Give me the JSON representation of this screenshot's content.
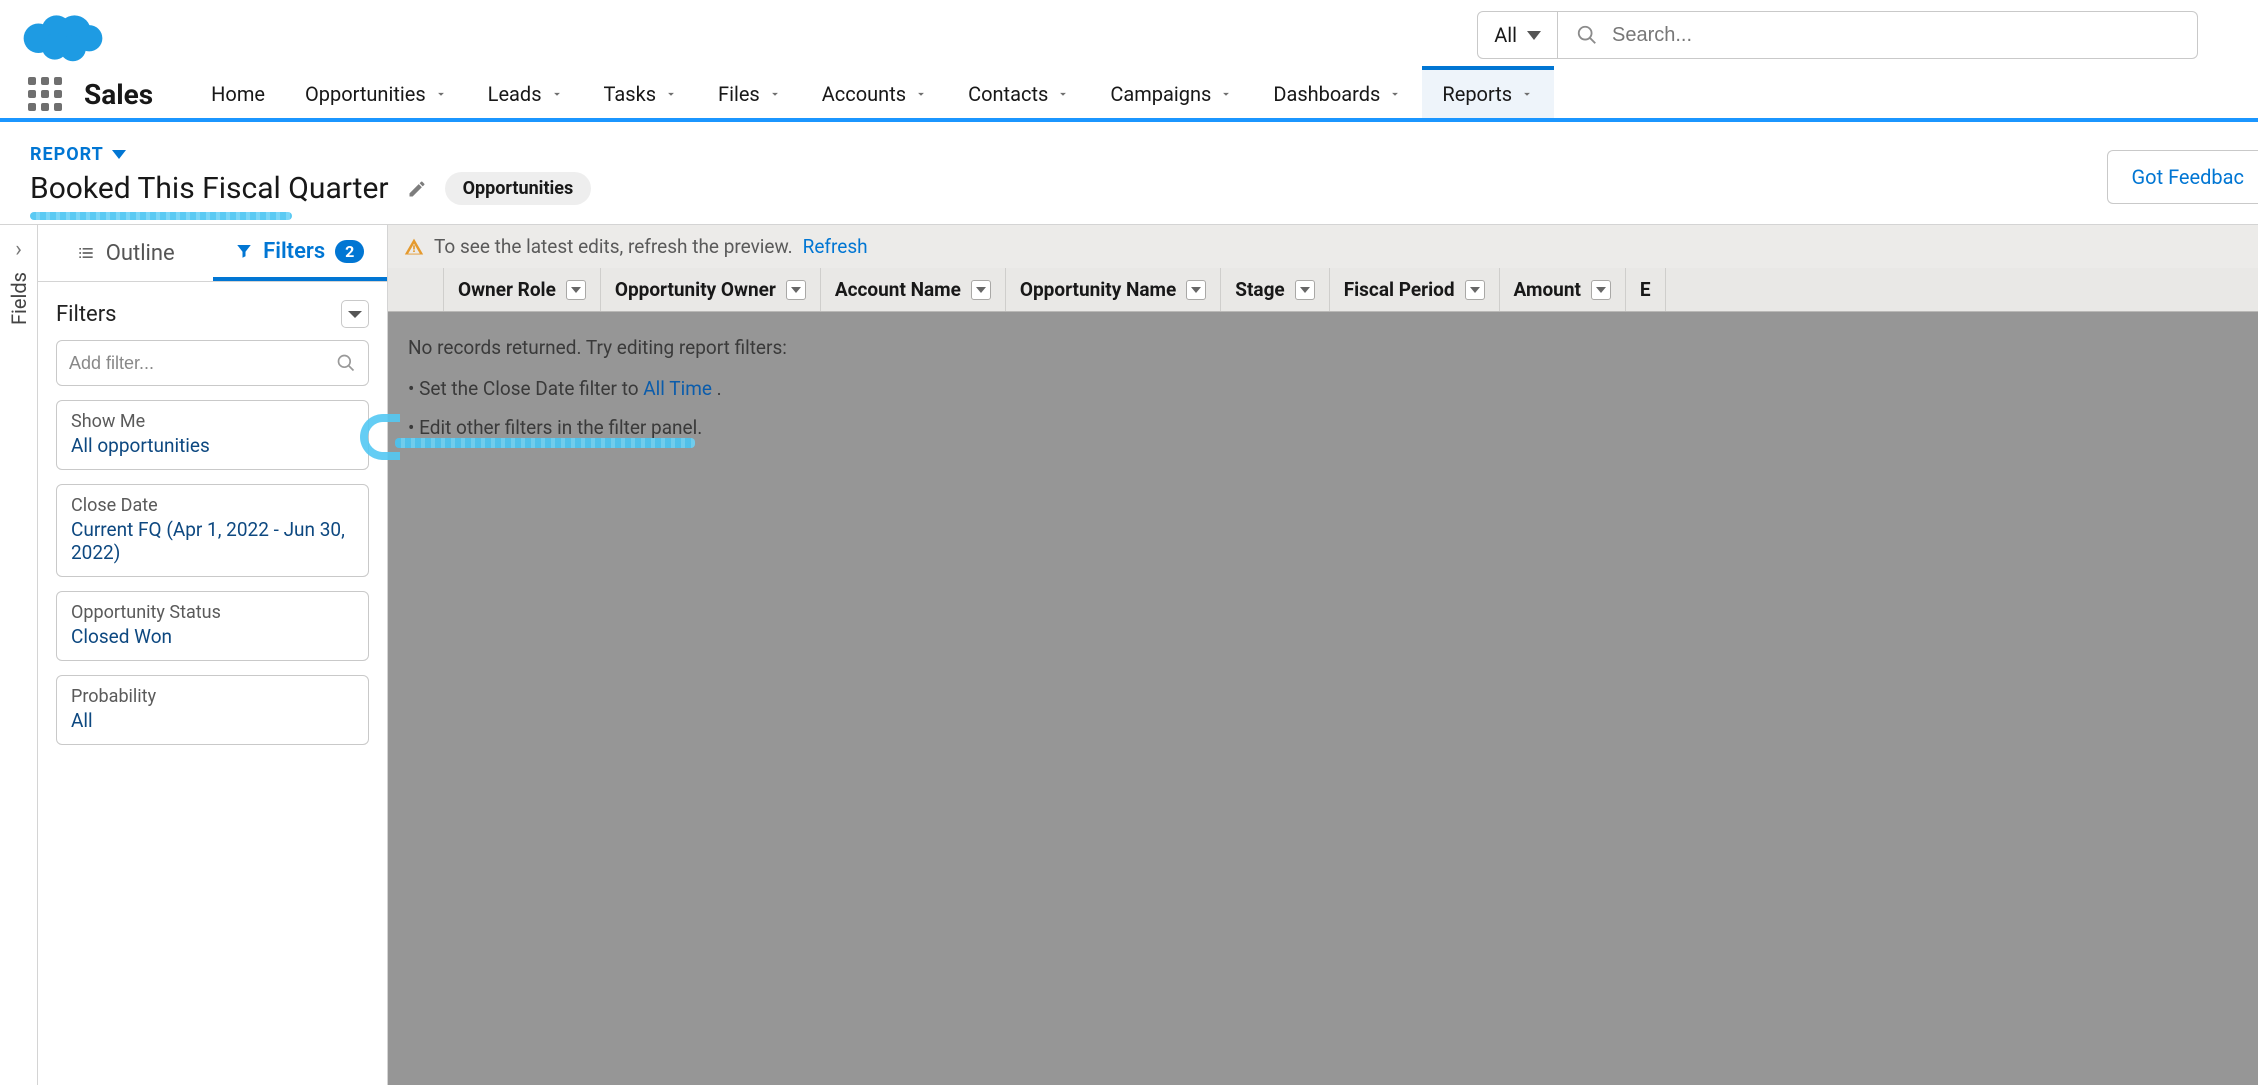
{
  "search": {
    "scope": "All",
    "placeholder": "Search..."
  },
  "appName": "Sales",
  "nav": [
    {
      "label": "Home",
      "hasMenu": false
    },
    {
      "label": "Opportunities",
      "hasMenu": true
    },
    {
      "label": "Leads",
      "hasMenu": true
    },
    {
      "label": "Tasks",
      "hasMenu": true
    },
    {
      "label": "Files",
      "hasMenu": true
    },
    {
      "label": "Accounts",
      "hasMenu": true
    },
    {
      "label": "Contacts",
      "hasMenu": true
    },
    {
      "label": "Campaigns",
      "hasMenu": true
    },
    {
      "label": "Dashboards",
      "hasMenu": true
    },
    {
      "label": "Reports",
      "hasMenu": true,
      "active": true
    }
  ],
  "report": {
    "typeLabel": "REPORT",
    "title": "Booked This Fiscal Quarter",
    "entityPill": "Opportunities",
    "feedback": "Got Feedbac"
  },
  "fieldsRail": "Fields",
  "panel": {
    "outlineLabel": "Outline",
    "filtersLabel": "Filters",
    "filtersCount": "2",
    "filtersTitle": "Filters",
    "addFilterPlaceholder": "Add filter...",
    "cards": [
      {
        "label": "Show Me",
        "value": "All opportunities"
      },
      {
        "label": "Close Date",
        "value": "Current FQ (Apr 1, 2022 - Jun 30, 2022)"
      },
      {
        "label": "Opportunity Status",
        "value": "Closed Won"
      },
      {
        "label": "Probability",
        "value": "All"
      }
    ]
  },
  "banner": {
    "text": "To see the latest edits, refresh the preview.",
    "refresh": "Refresh"
  },
  "columns": [
    "Owner Role",
    "Opportunity Owner",
    "Account Name",
    "Opportunity Name",
    "Stage",
    "Fiscal Period",
    "Amount",
    "E"
  ],
  "empty": {
    "line1": "No records returned. Try editing report filters:",
    "bullet1_prefix": "Set the Close Date filter to ",
    "bullet1_link": "All Time",
    "bullet1_suffix": ".",
    "bullet2": "Edit other filters in the filter panel."
  }
}
